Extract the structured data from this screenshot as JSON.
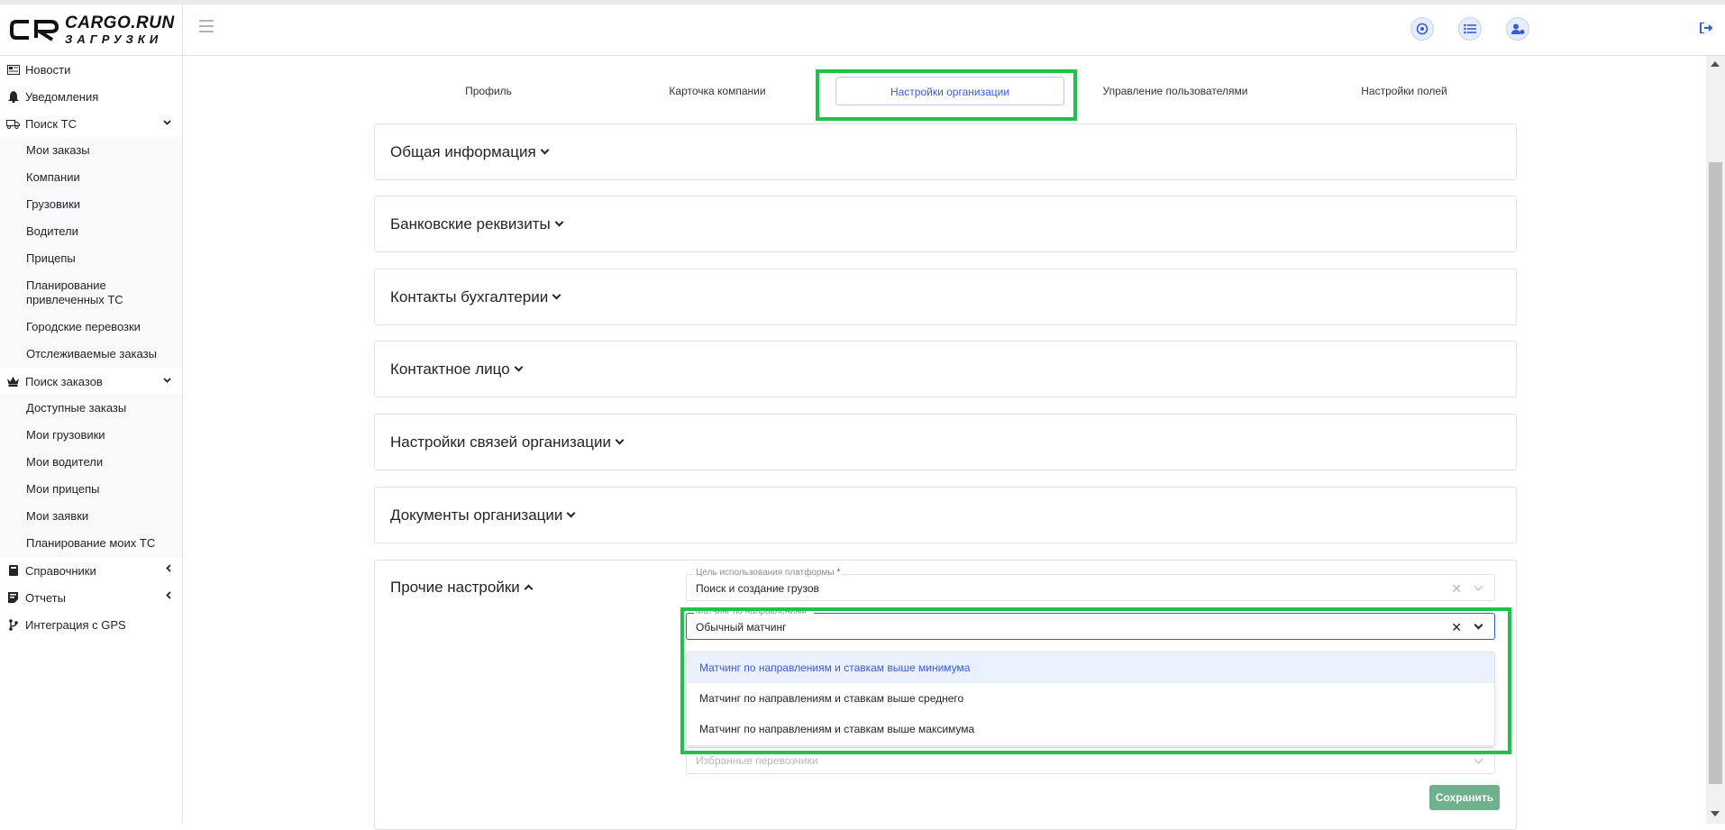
{
  "brand": {
    "title": "CARGO.RUN",
    "subtitle": "ЗАГРУЗКИ"
  },
  "sidebar": {
    "items": [
      {
        "label": "Новости",
        "icon": "newspaper-icon"
      },
      {
        "label": "Уведомления",
        "icon": "bell-icon"
      },
      {
        "label": "Поиск ТС",
        "icon": "truck-icon",
        "expanded": true,
        "children": [
          "Мои заказы",
          "Компании",
          "Грузовики",
          "Водители",
          "Прицепы",
          "Планирование привлеченных ТС",
          "Городские перевозки",
          "Отслеживаемые заказы"
        ]
      },
      {
        "label": "Поиск заказов",
        "icon": "crown-icon",
        "expanded": true,
        "children": [
          "Доступные заказы",
          "Мои грузовики",
          "Мои водители",
          "Мои прицепы",
          "Мои заявки",
          "Планирование моих ТС"
        ]
      },
      {
        "label": "Справочники",
        "icon": "book-icon",
        "expanded": false
      },
      {
        "label": "Отчеты",
        "icon": "report-icon",
        "expanded": false
      },
      {
        "label": "Интеграция с GPS",
        "icon": "branch-icon"
      }
    ]
  },
  "tabs": [
    {
      "label": "Профиль",
      "active": false
    },
    {
      "label": "Карточка компании",
      "active": false
    },
    {
      "label": "Настройки организации",
      "active": true
    },
    {
      "label": "Управление пользователями",
      "active": false
    },
    {
      "label": "Настройки полей",
      "active": false
    }
  ],
  "sections": [
    "Общая информация",
    "Банковские реквизиты",
    "Контакты бухгалтерии",
    "Контактное лицо",
    "Настройки связей организации",
    "Документы организации"
  ],
  "other_settings": {
    "title": "Прочие настройки",
    "platform_goal": {
      "label": "Цель использования платформы",
      "value": "Поиск и создание грузов"
    },
    "matching": {
      "label": "Матчинг по направлениям",
      "value": "Обычный матчинг",
      "options": [
        "Матчинг по направлениям и ставкам выше минимума",
        "Матчинг по направлениям и ставкам выше среднего",
        "Матчинг по направлениям и ставкам выше максимума"
      ]
    },
    "favorites": {
      "placeholder": "Избранные перевозчики"
    },
    "save_label": "Сохранить"
  },
  "colors": {
    "accent": "#3a5bd9",
    "highlight": "#1ec14a",
    "save": "#6fb08f"
  }
}
